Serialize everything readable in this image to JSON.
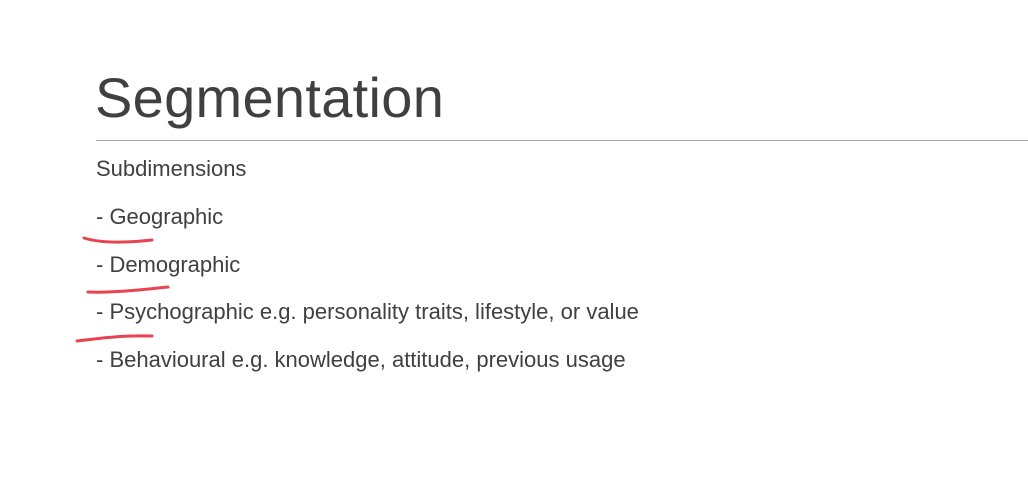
{
  "slide": {
    "title": "Segmentation",
    "subheading": "Subdimensions",
    "bullets": [
      "- Geographic",
      "- Demographic",
      "- Psychographic e.g. personality traits, lifestyle, or value",
      "- Behavioural e.g. knowledge, attitude, previous usage"
    ]
  },
  "annotations": {
    "ink_color": "#e8434f",
    "underlined_items": [
      "Geographic",
      "Demographic",
      "Psychographic"
    ]
  }
}
